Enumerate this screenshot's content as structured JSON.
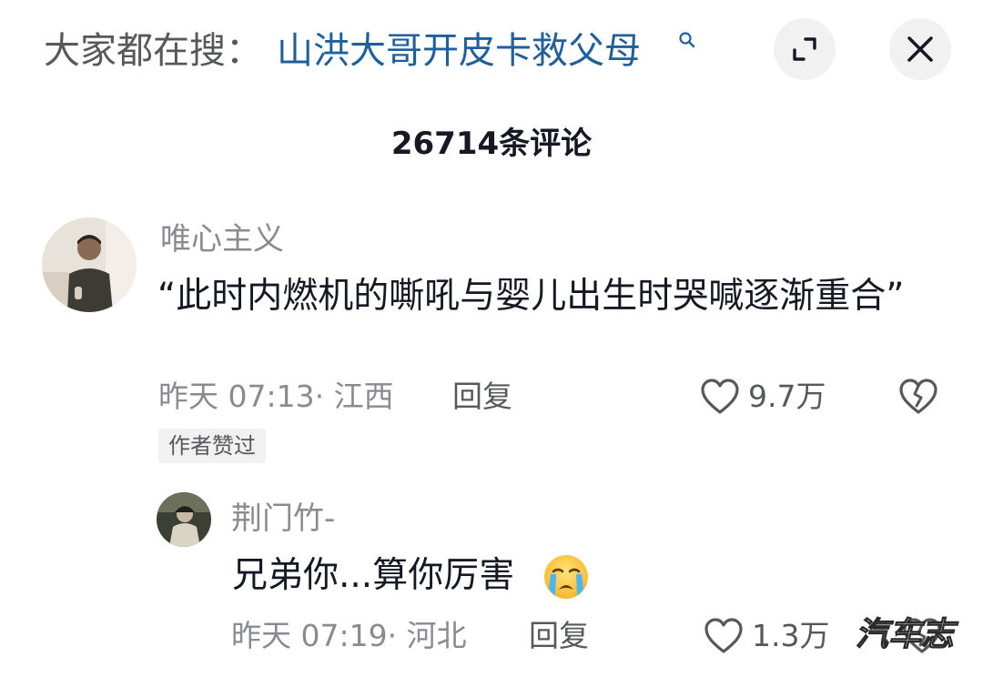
{
  "search_bar": {
    "prefix": "大家都在搜：",
    "term": "山洪大哥开皮卡救父母",
    "term_icon": "search-icon",
    "term_color": "#1f5f9c"
  },
  "header": {
    "expand_icon": "expand-icon",
    "close_icon": "close-icon",
    "comment_count": "26714条评论"
  },
  "comments": [
    {
      "username": "唯心主义",
      "text": "“此时内燃机的嘶吼与婴儿出生时哭喊逐渐重合”",
      "time": "昨天 07:13",
      "location": "· 江西",
      "reply_label": "回复",
      "likes": "9.7万",
      "tag": "作者赞过",
      "replies": [
        {
          "username": "荆门竹-",
          "text": "兄弟你...算你厉害",
          "emoji": "😭",
          "time": "昨天 07:19",
          "location": "· 河北",
          "reply_label": "回复",
          "likes": "1.3万"
        }
      ]
    }
  ],
  "watermark": "汽车志",
  "colors": {
    "primary_text": "#161823",
    "secondary_text": "#8a8b91",
    "link": "#1f5f9c",
    "button_bg": "#f1f1f2"
  }
}
